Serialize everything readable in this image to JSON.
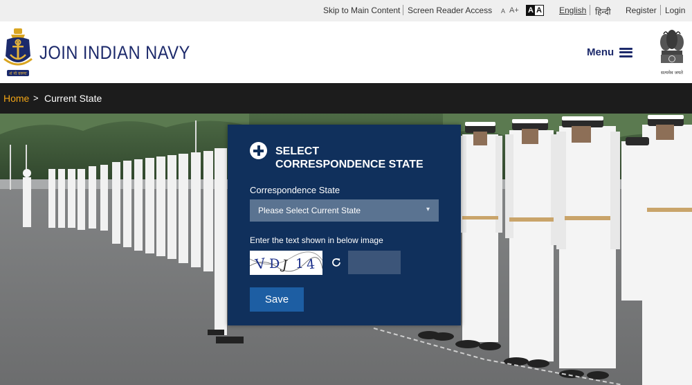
{
  "topbar": {
    "skip_link": "Skip to Main Content",
    "screen_reader": "Screen Reader Access",
    "font_small": "A",
    "font_large": "A+",
    "contrast_dark": "A",
    "contrast_light": "A",
    "lang_english": "English",
    "lang_hindi": "हिन्दी",
    "register": "Register",
    "login": "Login"
  },
  "header": {
    "brand": "JOIN INDIAN NAVY",
    "menu_label": "Menu",
    "emblem_motto": "सत्यमेव जयते"
  },
  "breadcrumb": {
    "home": "Home",
    "separator": ">",
    "current": "Current State"
  },
  "form": {
    "title_line1": "SELECT",
    "title_line2": "CORRESPONDENCE STATE",
    "state_label": "Correspondence State",
    "state_placeholder": "Please Select Current State",
    "captcha_label": "Enter the text shown in below image",
    "captcha_text": "VDJ14",
    "captcha_value": "",
    "save_label": "Save"
  },
  "colors": {
    "brand_navy": "#1d2a6b",
    "panel_bg": "#10305c",
    "select_bg": "#5a7391",
    "save_button": "#1d5ea3",
    "breadcrumb_home": "#f2a516",
    "breadcrumb_bg": "#1c1c1c"
  },
  "icons": {
    "logo": "navy-crest-icon",
    "emblem": "national-emblem-icon",
    "menu": "hamburger-icon",
    "add": "plus-circle-icon",
    "refresh": "refresh-icon",
    "dropdown": "chevron-down-icon"
  }
}
